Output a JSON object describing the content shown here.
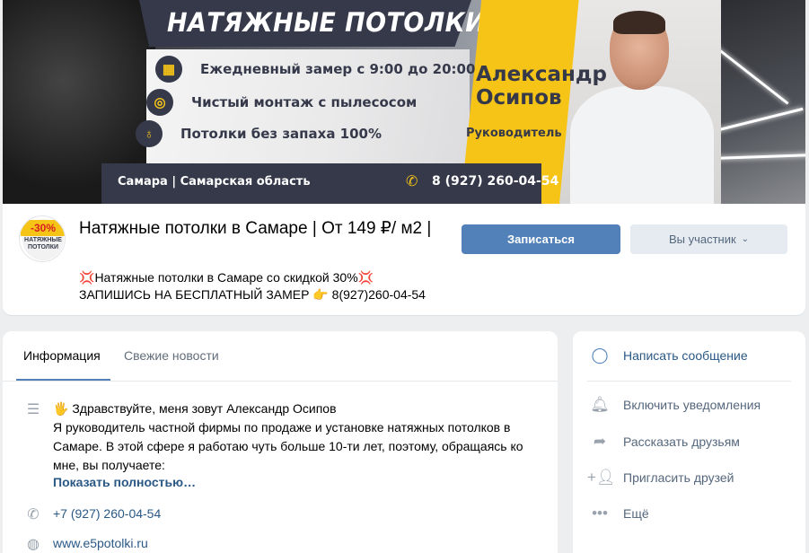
{
  "cover": {
    "title": "НАТЯЖНЫЕ ПОТОЛКИ",
    "features": [
      "Ежедневный замер с 9:00 до 20:00",
      "Чистый монтаж с пылесосом",
      "Потолки без запаха 100%"
    ],
    "person_name_line1": "Александр",
    "person_name_line2": "Осипов",
    "person_role": "Руководитель",
    "city": "Самара | Самарская область",
    "phone": "8 (927) 260-04-54"
  },
  "avatar": {
    "sale": "-30%",
    "brand": "НАТЯЖНЫЕ ПОТОЛКИ"
  },
  "group": {
    "title": "Натяжные потолки в Самаре | От 149 ₽/ м2 |",
    "status_line1": "Натяжные потолки в Самаре со скидкой 30%",
    "status_line2_prefix": "ЗАПИШИСЬ НА БЕСПЛАТНЫЙ ЗАМЕР",
    "status_line2_phone": "8(927)260-04-54",
    "emoji_collision": "💢",
    "emoji_point": "👉"
  },
  "buttons": {
    "subscribe": "Записаться",
    "member": "Вы участник"
  },
  "info": {
    "tabs": [
      "Информация",
      "Свежие новости"
    ],
    "greeting_emoji": "🖐",
    "greeting": "Здравствуйте, меня зовут Александр Осипов",
    "description": "Я руководитель частной фирмы по продаже и установке натяжных потолков в Самаре. В этой сфере я работаю чуть больше 10-ти лет, поэтому, обращаясь ко мне, вы получаете:",
    "show_more": "Показать полностью…",
    "phone": "+7 (927) 260-04-54",
    "website": "www.e5potolki.ru"
  },
  "actions": {
    "items": [
      {
        "label": "Написать сообщение",
        "icon": "message-icon"
      },
      {
        "label": "Включить уведомления",
        "icon": "bell-icon"
      },
      {
        "label": "Рассказать друзьям",
        "icon": "share-icon"
      },
      {
        "label": "Пригласить друзей",
        "icon": "add-user-icon"
      },
      {
        "label": "Ещё",
        "icon": "more-icon"
      }
    ]
  }
}
